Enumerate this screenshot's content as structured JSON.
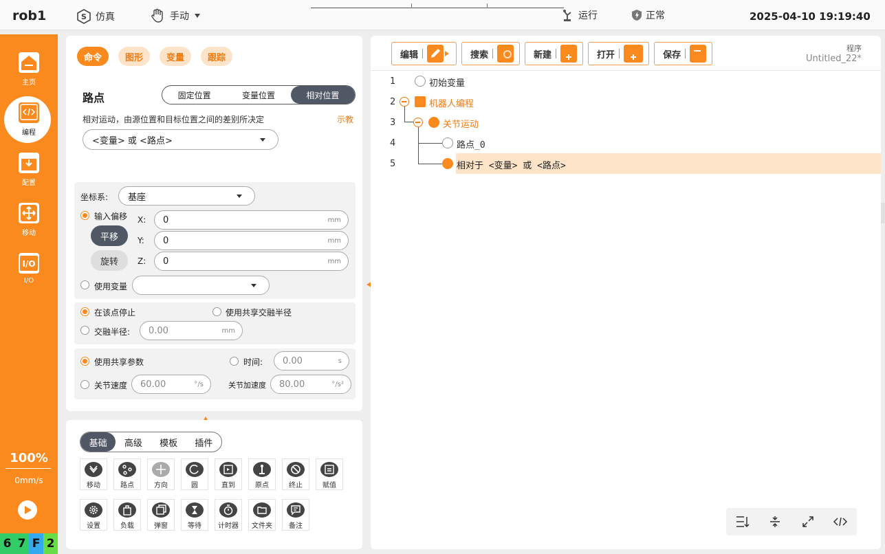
{
  "topbar": {
    "robot_name": "rob1",
    "sim_label": "仿真",
    "mode_label": "手动",
    "run_label": "运行",
    "status_label": "正常",
    "datetime": "2025-04-10 19:19:40"
  },
  "sidebar": {
    "items": [
      {
        "label": "主页",
        "icon": "home-icon"
      },
      {
        "label": "编程",
        "icon": "code-icon"
      },
      {
        "label": "配置",
        "icon": "config-icon"
      },
      {
        "label": "移动",
        "icon": "move-icon"
      },
      {
        "label": "I/O",
        "icon": "io-icon"
      }
    ],
    "speed_percent": "100%",
    "speed_mm": "0mm/s",
    "status_cells": [
      {
        "text": "6",
        "color": "#33cc66"
      },
      {
        "text": "7",
        "color": "#33cc66"
      },
      {
        "text": "F",
        "color": "#33aaee"
      },
      {
        "text": "2",
        "color": "#66dd44"
      }
    ]
  },
  "config": {
    "tabs": [
      "命令",
      "图形",
      "变量",
      "跟踪"
    ],
    "title": "路点",
    "position_modes": [
      "固定位置",
      "变量位置",
      "相对位置"
    ],
    "description": "相对运动，由源位置和目标位置之间的差别所决定",
    "teach_label": "示教",
    "relative_select": "<变量> 或 <路点>",
    "coord_label": "坐标系:",
    "coord_value": "基座",
    "input_offset_label": "输入偏移",
    "translate_label": "平移",
    "rotate_label": "旋转",
    "x_label": "X:",
    "x_value": "0",
    "y_label": "Y:",
    "y_value": "0",
    "z_label": "Z:",
    "z_value": "0",
    "mm_unit": "mm",
    "use_var_label": "使用变量",
    "stop_here_label": "在该点停止",
    "shared_blend_label": "使用共享交融半径",
    "blend_label": "交融半径:",
    "blend_value": "0.00",
    "shared_param_label": "使用共享参数",
    "time_label": "时间:",
    "time_value": "0.00",
    "time_unit": "s",
    "joint_speed_label": "关节速度",
    "joint_speed_value": "60.00",
    "joint_speed_unit": "°/s",
    "joint_acc_label": "关节加速度",
    "joint_acc_value": "80.00",
    "joint_acc_unit": "°/s²"
  },
  "palette": {
    "tabs": [
      "基础",
      "高级",
      "模板",
      "插件"
    ],
    "row1": [
      "移动",
      "路点",
      "方向",
      "圆",
      "直到",
      "原点",
      "终止",
      "赋值"
    ],
    "row2": [
      "设置",
      "负载",
      "弹窗",
      "等待",
      "计时器",
      "文件夹",
      "备注"
    ]
  },
  "program": {
    "toolbar": [
      "编辑",
      "搜索",
      "新建",
      "打开",
      "保存"
    ],
    "label": "程序",
    "name": "Untitled_22*",
    "lines": [
      {
        "no": "1",
        "text": "初始变量"
      },
      {
        "no": "2",
        "text": "机器人编程"
      },
      {
        "no": "3",
        "text": "关节运动"
      },
      {
        "no": "4",
        "text": "路点_0"
      },
      {
        "no": "5",
        "text": "相对于 <变量> 或 <路点>"
      }
    ]
  },
  "colors": {
    "accent": "#fa8a1e",
    "dark": "#505866"
  }
}
